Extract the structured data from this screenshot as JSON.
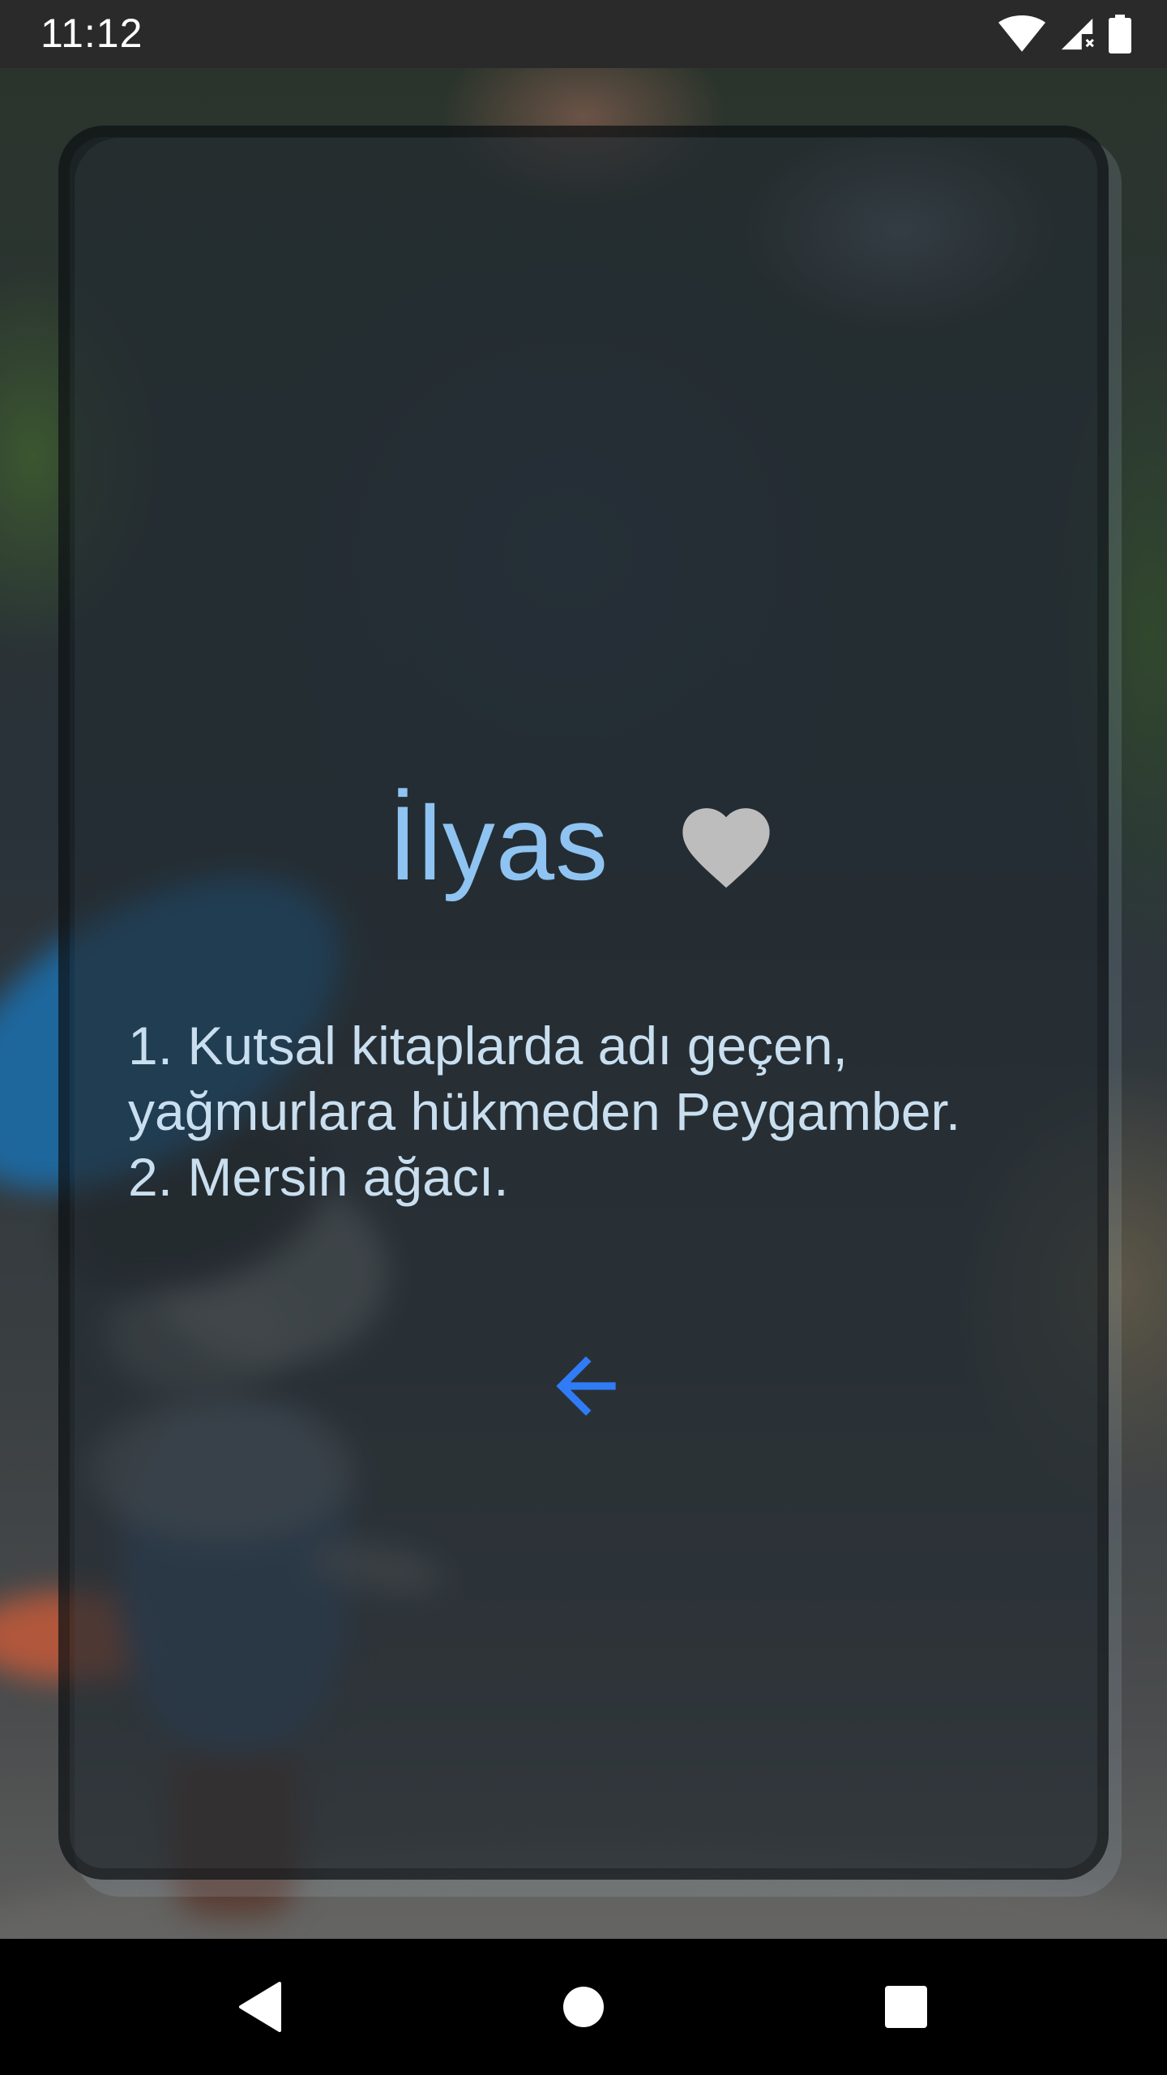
{
  "status_bar": {
    "time": "11:12",
    "icons": [
      "wifi-icon",
      "cell-signal-icon",
      "battery-icon"
    ]
  },
  "card": {
    "word": "İlyas",
    "favorite_icon": "heart-icon",
    "definitions": [
      "1. Kutsal kitaplarda adı geçen,",
      "yağmurlara hükmeden Peygamber.",
      "2. Mersin ağacı."
    ],
    "back_icon": "arrow-left-icon"
  },
  "nav_bar": {
    "buttons": [
      "back-triangle-icon",
      "home-circle-icon",
      "recents-square-icon"
    ]
  },
  "colors": {
    "title": "#8fc3f1",
    "text": "#c9dff0",
    "heart": "#bdbdbd",
    "accent_arrow": "#2f7cf6",
    "status_bar": "#2a2a2a",
    "nav_bar": "#000000"
  }
}
